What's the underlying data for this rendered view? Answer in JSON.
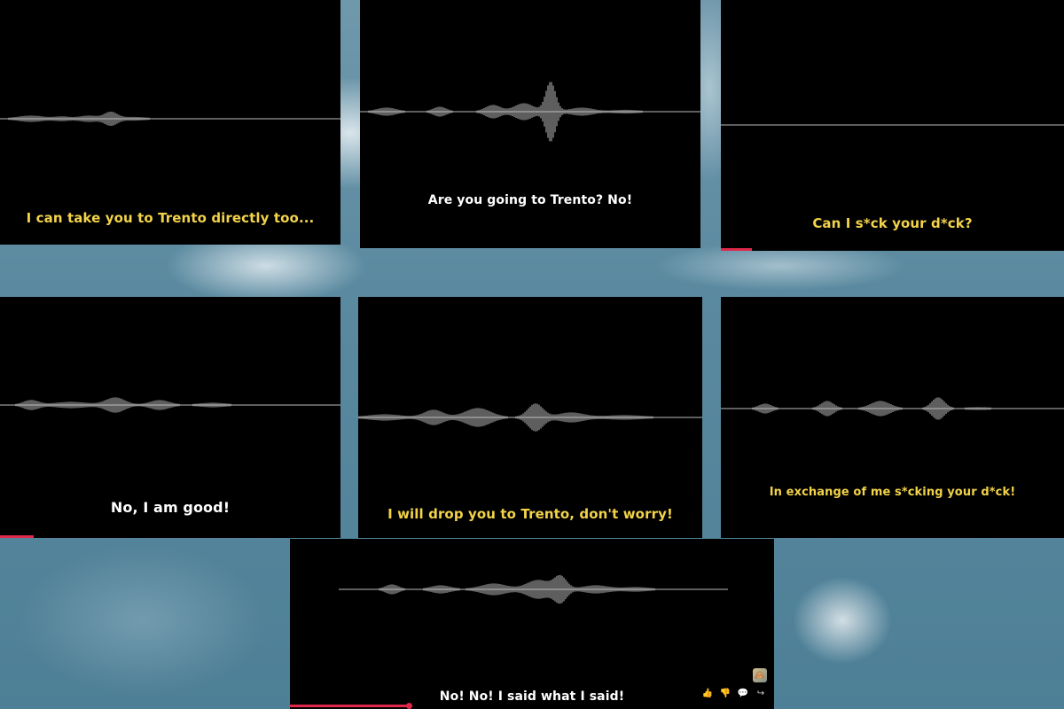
{
  "colors": {
    "caption_yellow": "#f2d349",
    "caption_white": "#ffffff",
    "progress": "#e0284a",
    "wave": "#bdbdbd"
  },
  "panels": [
    {
      "id": "p1",
      "caption": "I can take you to Trento directly too...",
      "caption_color": "yellow",
      "progress": 0
    },
    {
      "id": "p2",
      "caption": "Are you going to Trento? No!",
      "caption_color": "white",
      "progress": 0
    },
    {
      "id": "p3",
      "caption": "Can I s*ck your d*ck?",
      "caption_color": "yellow",
      "progress": 0.09
    },
    {
      "id": "p4",
      "caption": "No, I am good!",
      "caption_color": "white",
      "progress": 0.1
    },
    {
      "id": "p5",
      "caption": "I will drop you to Trento, don't worry!",
      "caption_color": "yellow",
      "progress": 0
    },
    {
      "id": "p6",
      "caption": "In exchange of me s*cking your d*ck!",
      "caption_color": "yellow",
      "progress": 0
    },
    {
      "id": "p7",
      "caption": "No! No! I said what I said!",
      "caption_color": "white",
      "progress": 0.25
    }
  ],
  "actions": {
    "icons": [
      "thumbs-up-icon",
      "thumbs-down-icon",
      "comment-icon",
      "share-icon"
    ],
    "glyphs": [
      "👍",
      "👎",
      "💬",
      "↪"
    ]
  }
}
